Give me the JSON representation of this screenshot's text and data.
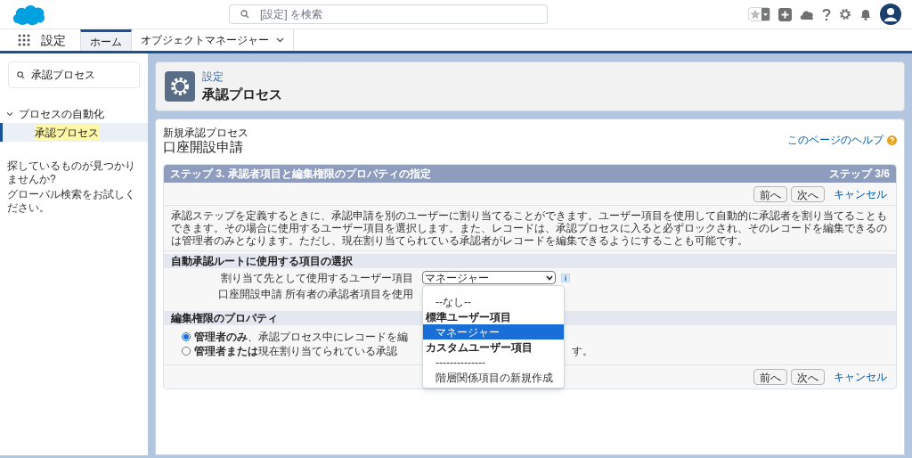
{
  "header": {
    "search_placeholder": "[設定] を検索"
  },
  "nav": {
    "app_name": "設定",
    "tabs": [
      {
        "label": "ホーム",
        "selected": true
      },
      {
        "label": "オブジェクトマネージャー",
        "selected": false,
        "dropdown": true
      }
    ]
  },
  "sidebar": {
    "search_value": "承認プロセス",
    "tree": [
      {
        "label": "プロセスの自動化",
        "expanded": true,
        "selected": false,
        "children": [
          {
            "label": "承認プロセス",
            "selected": true
          }
        ]
      }
    ],
    "help_lines": [
      "探しているものが見つかりませんか?",
      "グローバル検索をお試しください。"
    ]
  },
  "page_header": {
    "breadcrumb": "設定",
    "title": "承認プロセス"
  },
  "main": {
    "subtitle": "新規承認プロセス",
    "title": "口座開設申請",
    "help_link": "このページのヘルプ",
    "step_title": "ステップ 3. 承認者項目と編集権限のプロパティの指定",
    "step_count": "ステップ 3/6",
    "top_buttons": [
      "前へ",
      "次へ"
    ],
    "top_cancel": "キャンセル",
    "description": "承認ステップを定義するときに、承認申請を別のユーザーに割り当てることができます。ユーザー項目を使用して自動的に承認者を割り当てることもできます。その場合に使用するユーザー項目を選択します。また、レコードは、承認プロセスに入ると必ずロックされ、そのレコードを編集できるのは管理者のみとなります。ただし、現在割り当てられている承認者がレコードを編集できるようにすることも可能です。",
    "approver_section": {
      "title": "自動承認ルートに使用する項目の選択",
      "field_label": "割り当て先として使用するユーザー項目",
      "select_value": "マネージャー",
      "owner_option": "口座開設申請 所有者の承認者項目を使用",
      "dropdown": [
        {
          "kind": "option",
          "label": "--なし--",
          "selected": false
        },
        {
          "kind": "group",
          "label": "標準ユーザー項目"
        },
        {
          "kind": "option",
          "label": "マネージャー",
          "selected": true
        },
        {
          "kind": "group",
          "label": "カスタムユーザー項目"
        },
        {
          "kind": "option",
          "label": "--------------",
          "selected": false
        },
        {
          "kind": "option",
          "label": "階層関係項目の新規作成",
          "selected": false
        }
      ]
    },
    "edit_section": {
      "title": "編集権限のプロパティ",
      "radios": [
        {
          "label": "**管理者のみ**、承認プロセス中にレコードを編",
          "selected": true
        },
        {
          "label": "**管理者または**現在割り当てられている承認",
          "selected": false,
          "tail": "す。"
        }
      ]
    },
    "bottom_buttons": [
      "前へ",
      "次へ"
    ],
    "bottom_cancel": "キャンセル"
  }
}
